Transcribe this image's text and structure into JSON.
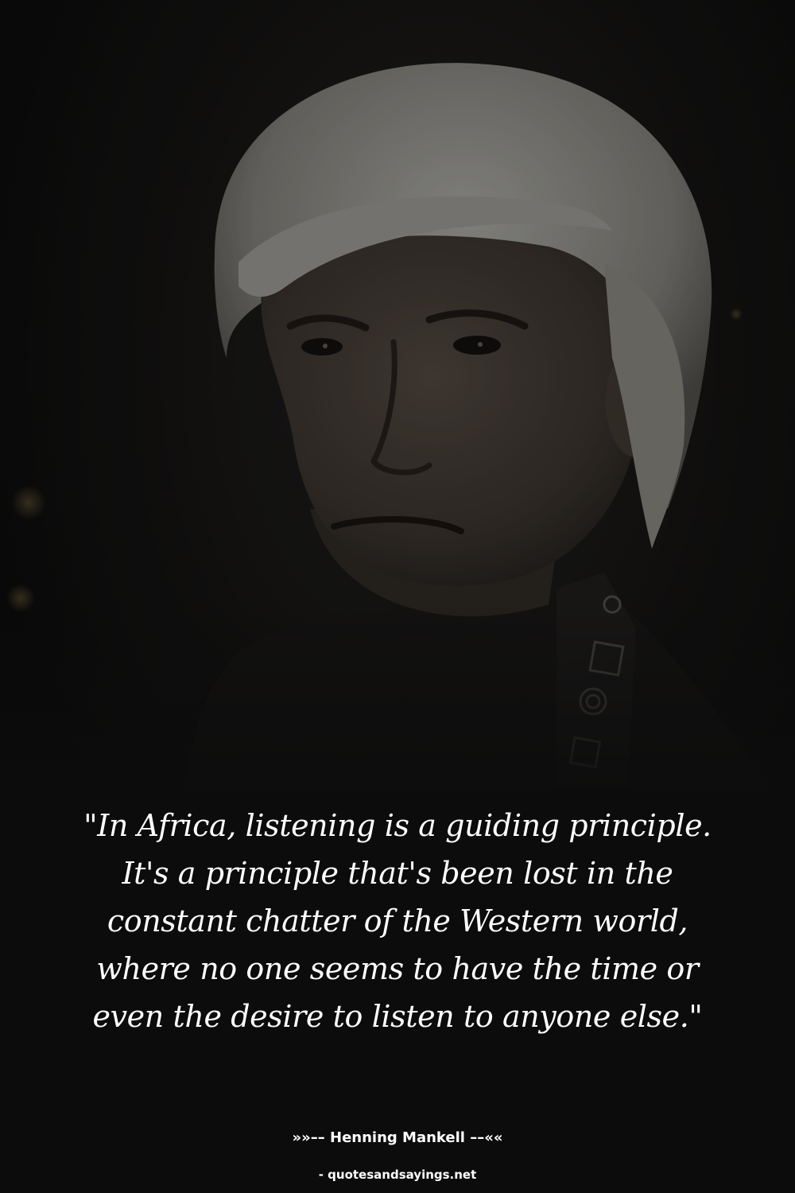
{
  "quote": {
    "text": "\"In Africa, listening is a guiding principle. It's a principle that's been lost in the constant chatter of the Western world, where no one seems to have the time or even the desire to listen to anyone else.\"",
    "author_line": "»»–– Henning Mankell ––««",
    "source": "- quotesandsayings.net"
  },
  "colors": {
    "background": "#0c0c0c",
    "text": "#ffffff",
    "hair": "#8a8a86",
    "skin": "#3e3731"
  }
}
